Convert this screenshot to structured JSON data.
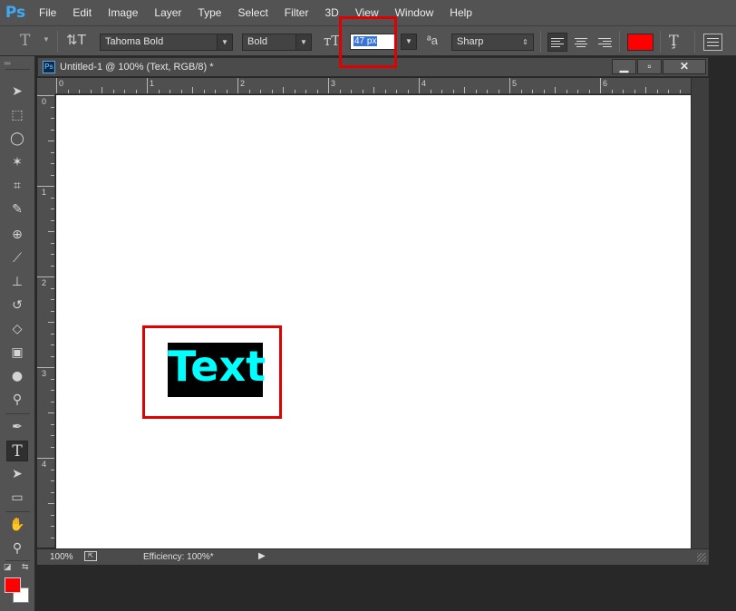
{
  "app": {
    "logo": "Ps"
  },
  "menu": [
    "File",
    "Edit",
    "Image",
    "Layer",
    "Type",
    "Select",
    "Filter",
    "3D",
    "View",
    "Window",
    "Help"
  ],
  "options_bar": {
    "font_family": "Tahoma Bold",
    "font_style": "Bold",
    "font_size": "47 px",
    "anti_alias": "Sharp",
    "text_color": "#ff0000"
  },
  "toolbox": {
    "active_tool": "type-tool",
    "foreground_color": "#ff0000",
    "background_color": "#ffffff"
  },
  "document": {
    "tab_icon": "Ps",
    "title": "Untitled-1 @ 100% (Text, RGB/8) *",
    "window_buttons": {
      "minimize": "▁",
      "restore": "▫",
      "close": "✕"
    },
    "ruler_h": [
      "0",
      "1",
      "2",
      "3",
      "4",
      "5",
      "6"
    ],
    "ruler_v": [
      "0",
      "1",
      "2",
      "3",
      "4"
    ],
    "text_layer": {
      "content": "Text",
      "text_color": "#00ffff",
      "highlight_bg": "#000000"
    }
  },
  "statusbar": {
    "zoom": "100%",
    "efficiency": "Efficiency: 100%*"
  },
  "annotations": {
    "highlight_color": "#e00000"
  }
}
